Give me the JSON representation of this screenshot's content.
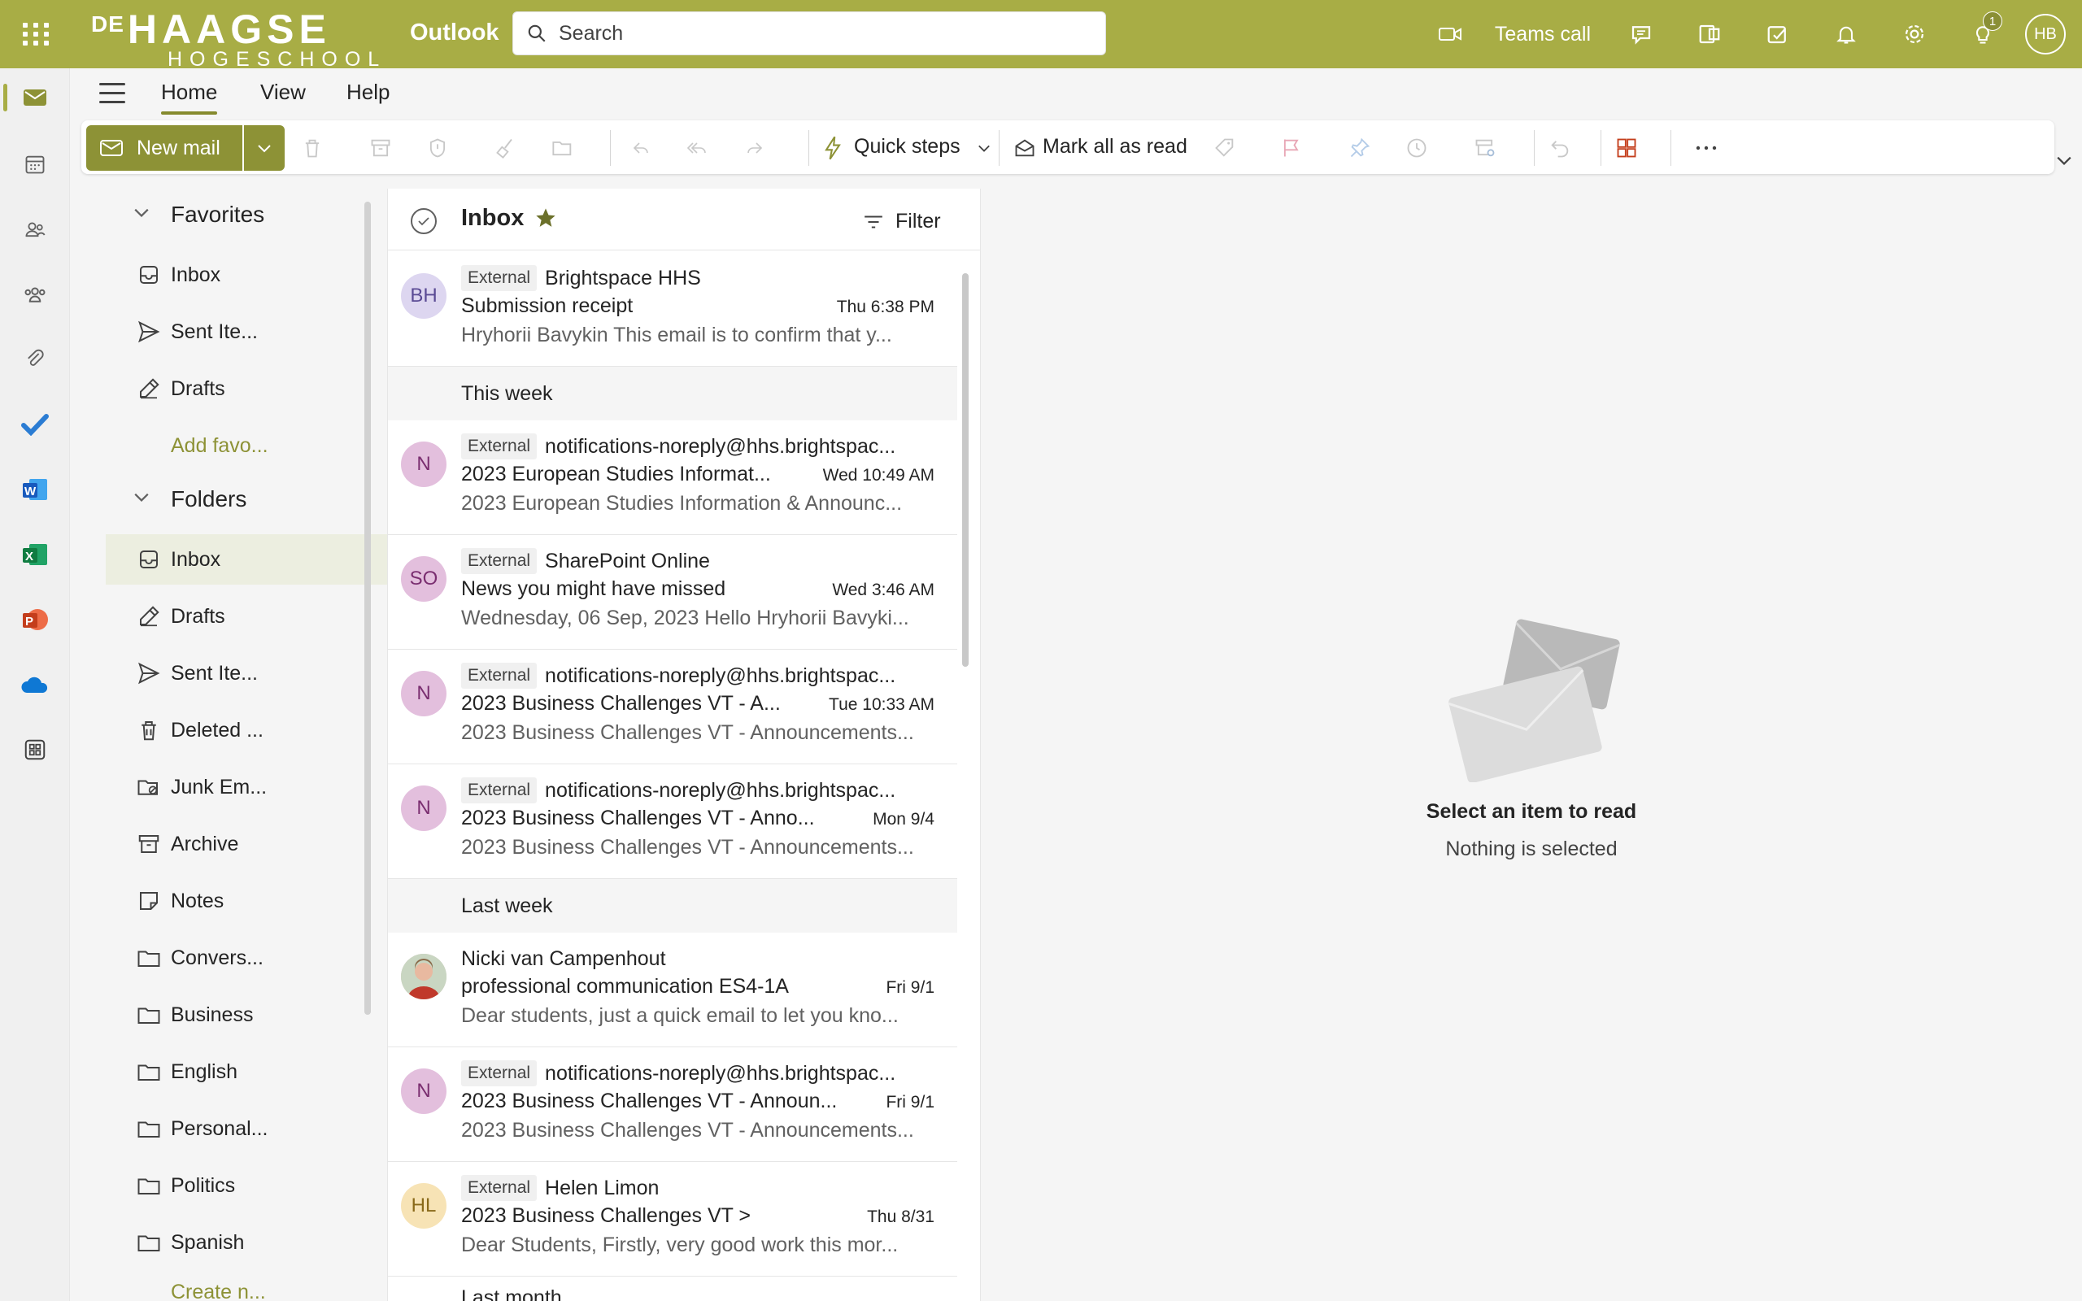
{
  "colors": {
    "brand": "#a8ad45",
    "brand_dark": "#8d9236",
    "accent_text": "#8d9236"
  },
  "topbar": {
    "logo_line1_prefix": "DE",
    "logo_line1": "HAAGSE",
    "logo_line2": "HOGESCHOOL",
    "app_name": "Outlook",
    "search_placeholder": "Search",
    "teams_call": "Teams call",
    "notification_count": "1",
    "user_initials": "HB"
  },
  "tabs": {
    "home": "Home",
    "view": "View",
    "help": "Help"
  },
  "ribbon": {
    "new_mail": "New mail",
    "quick_steps": "Quick steps",
    "mark_all_read": "Mark all as read"
  },
  "folders": {
    "favorites_heading": "Favorites",
    "folders_heading": "Folders",
    "favorites": [
      {
        "label": "Inbox",
        "icon": "inbox-icon"
      },
      {
        "label": "Sent Ite...",
        "icon": "send-icon"
      },
      {
        "label": "Drafts",
        "icon": "pencil-icon"
      },
      {
        "label": "Add favo...",
        "icon": ""
      }
    ],
    "items": [
      {
        "label": "Inbox",
        "icon": "inbox-icon"
      },
      {
        "label": "Drafts",
        "icon": "pencil-icon"
      },
      {
        "label": "Sent Ite...",
        "icon": "send-icon"
      },
      {
        "label": "Deleted ...",
        "icon": "trash-icon"
      },
      {
        "label": "Junk Em...",
        "icon": "junk-icon"
      },
      {
        "label": "Archive",
        "icon": "archive-icon"
      },
      {
        "label": "Notes",
        "icon": "note-icon"
      },
      {
        "label": "Convers...",
        "icon": "folder-icon"
      },
      {
        "label": "Business",
        "icon": "folder-icon"
      },
      {
        "label": "English",
        "icon": "folder-icon"
      },
      {
        "label": "Personal...",
        "icon": "folder-icon"
      },
      {
        "label": "Politics",
        "icon": "folder-icon"
      },
      {
        "label": "Spanish",
        "icon": "folder-icon"
      },
      {
        "label": "Create n...",
        "icon": ""
      }
    ]
  },
  "list": {
    "title": "Inbox",
    "filter": "Filter",
    "groups": {
      "this_week": "This week",
      "last_week": "Last week",
      "last_month": "Last month"
    },
    "messages": [
      {
        "initials": "BH",
        "external": "External",
        "sender": "Brightspace HHS",
        "subject": "Submission receipt",
        "date": "Thu 6:38 PM",
        "preview": "Hryhorii Bavykin This email is to confirm that y..."
      },
      {
        "initials": "N",
        "external": "External",
        "sender": "notifications-noreply@hhs.brightspac...",
        "subject": "2023 European Studies Informat...",
        "date": "Wed 10:49 AM",
        "preview": "2023 European Studies Information & Announc..."
      },
      {
        "initials": "SO",
        "external": "External",
        "sender": "SharePoint Online",
        "subject": "News you might have missed",
        "date": "Wed 3:46 AM",
        "preview": "Wednesday, 06 Sep, 2023 Hello Hryhorii Bavyki..."
      },
      {
        "initials": "N",
        "external": "External",
        "sender": "notifications-noreply@hhs.brightspac...",
        "subject": "2023 Business Challenges VT - A...",
        "date": "Tue 10:33 AM",
        "preview": "2023 Business Challenges VT - Announcements..."
      },
      {
        "initials": "N",
        "external": "External",
        "sender": "notifications-noreply@hhs.brightspac...",
        "subject": "2023 Business Challenges VT - Anno...",
        "date": "Mon 9/4",
        "preview": "2023 Business Challenges VT - Announcements..."
      },
      {
        "initials": "",
        "external": "",
        "sender": "Nicki van Campenhout",
        "subject": "professional communication ES4-1A",
        "date": "Fri 9/1",
        "preview": "Dear students, just a quick email to let you kno..."
      },
      {
        "initials": "N",
        "external": "External",
        "sender": "notifications-noreply@hhs.brightspac...",
        "subject": "2023 Business Challenges VT - Announ...",
        "date": "Fri 9/1",
        "preview": "2023 Business Challenges VT - Announcements..."
      },
      {
        "initials": "HL",
        "external": "External",
        "sender": "Helen Limon",
        "subject": "2023 Business Challenges VT >",
        "date": "Thu 8/31",
        "preview": "Dear Students, Firstly, very good work this mor..."
      }
    ]
  },
  "reading": {
    "title": "Select an item to read",
    "subtitle": "Nothing is selected"
  }
}
